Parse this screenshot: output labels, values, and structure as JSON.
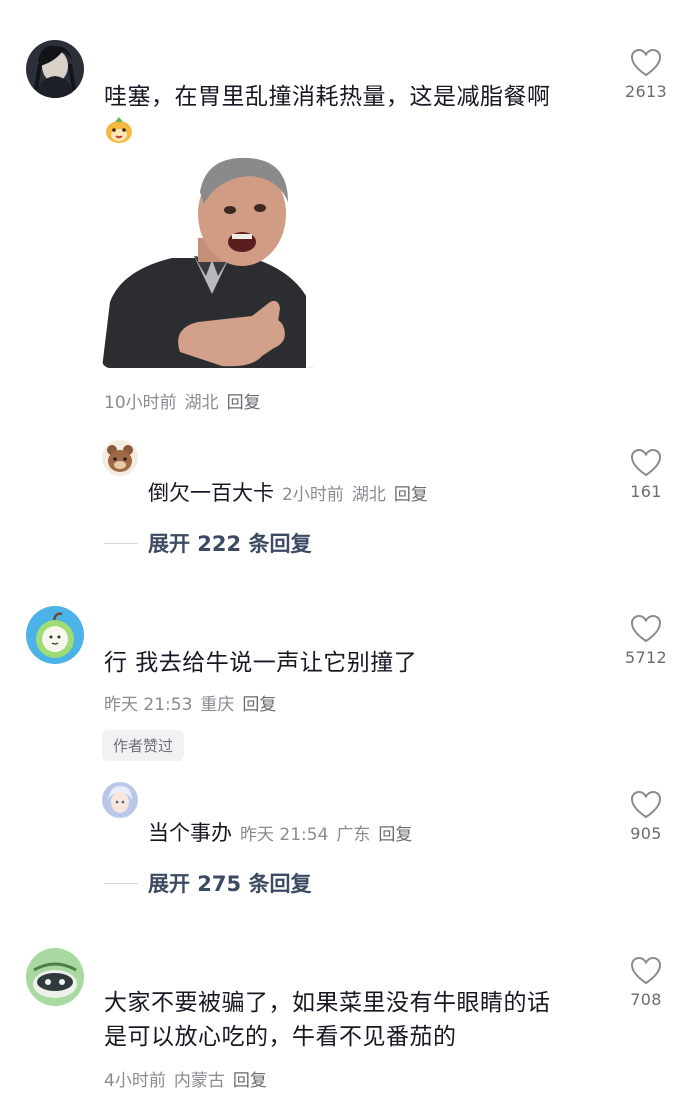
{
  "comments": [
    {
      "text": "哇塞，在胃里乱撞消耗热量，这是减脂餐啊",
      "emoji": "cute-pet-emoji",
      "image": "meme-sticker-elderly-man",
      "time": "10小时前",
      "location": "湖北",
      "reply_label": "回复",
      "likes": "2613",
      "sub_reply": {
        "text": "倒欠一百大卡",
        "time": "2小时前",
        "location": "湖北",
        "reply_label": "回复",
        "likes": "161"
      },
      "expand_label": "展开 222 条回复"
    },
    {
      "text": "行 我去给牛说一声让它别撞了",
      "time": "昨天 21:53",
      "location": "重庆",
      "reply_label": "回复",
      "likes": "5712",
      "badge": "作者赞过",
      "sub_reply": {
        "text": "当个事办",
        "time": "昨天 21:54",
        "location": "广东",
        "reply_label": "回复",
        "likes": "905"
      },
      "expand_label": "展开 275 条回复"
    },
    {
      "text_line1": "大家不要被骗了，如果菜里没有牛眼睛的话",
      "text_line2": "是可以放心吃的，牛看不见番茄的",
      "time": "4小时前",
      "location": "内蒙古",
      "reply_label": "回复",
      "likes": "708"
    }
  ],
  "colors": {
    "text": "#161823",
    "meta": "#8a8b91",
    "expand": "#3d4a63",
    "badge_bg": "#f2f2f4"
  }
}
